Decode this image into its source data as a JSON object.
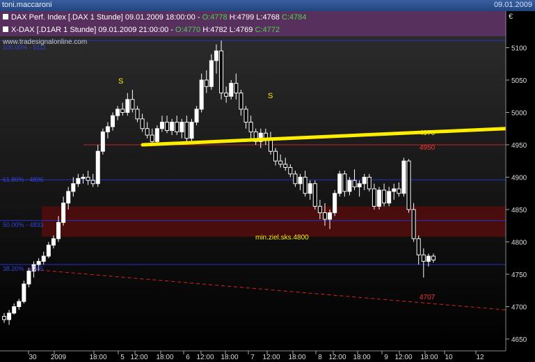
{
  "window": {
    "title": "toni.maccaroni",
    "date": "09.01.2009"
  },
  "legend": [
    {
      "text": "DAX Perf. Index [.DAX  1 Stunde] 09.01.2009 18:00:00 - ",
      "o": "O:4778",
      "h": "H:4799",
      "l": "L:4768",
      "c": "C:4784"
    },
    {
      "text": "X-DAX [.D1AR  1 Stunde] 09.01.2009 21:00:00 - ",
      "o": "O:4770",
      "h": "H:4782",
      "l": "L:4769",
      "c": "C:4772"
    }
  ],
  "watermark": "www.tradesignalonline.com",
  "currency": "€",
  "annotations": {
    "s1": "S",
    "s2": "S",
    "level_4970": "4970",
    "level_4950": "4950",
    "level_4707": "4707",
    "target": "min.ziel.sks.4800"
  },
  "fib_labels": [
    "61.80% - 4896",
    "50.00% - 4833",
    "38.20% - 4765",
    "100.00% - 5111"
  ],
  "colors": {
    "up": "#ffffff",
    "down": "#ffffff",
    "trend": "#ffee00",
    "support_red": "#cc2222",
    "zone": "#4a0d0d",
    "hline": "#2233cc",
    "bg_top": "#2e2e2e",
    "bg_bottom": "#000000"
  },
  "chart_data": {
    "type": "candlestick",
    "y_ticks": [
      4650,
      4700,
      4750,
      4800,
      4850,
      4900,
      4950,
      5000,
      5050,
      5100
    ],
    "y_tick_labels": [
      "4650",
      "4700",
      "4750",
      "4800",
      "4850",
      "4900",
      "4950",
      "5000",
      "5050",
      "5100"
    ],
    "ylim": [
      4630,
      5135
    ],
    "x_labels": [
      "30",
      "2009",
      "18:00",
      "5",
      "12:00",
      "18:00",
      "6",
      "12:00",
      "18:00",
      "7",
      "12:00",
      "18:00",
      "8",
      "12:00",
      "18:00",
      "9",
      "12:00",
      "18:00",
      "10",
      "12"
    ],
    "horizontal_lines": [
      5111,
      4896,
      4833,
      4765
    ],
    "red_level": 4950,
    "zone": [
      4808,
      4855
    ],
    "candles": [
      [
        4685,
        4690,
        4675,
        4680
      ],
      [
        4680,
        4695,
        4672,
        4690
      ],
      [
        4690,
        4705,
        4688,
        4700
      ],
      [
        4700,
        4712,
        4695,
        4708
      ],
      [
        4708,
        4740,
        4705,
        4735
      ],
      [
        4735,
        4760,
        4730,
        4755
      ],
      [
        4755,
        4770,
        4745,
        4765
      ],
      [
        4765,
        4775,
        4755,
        4770
      ],
      [
        4770,
        4785,
        4765,
        4778
      ],
      [
        4778,
        4800,
        4775,
        4795
      ],
      [
        4795,
        4810,
        4790,
        4805
      ],
      [
        4805,
        4840,
        4800,
        4830
      ],
      [
        4830,
        4870,
        4825,
        4860
      ],
      [
        4860,
        4885,
        4850,
        4878
      ],
      [
        4878,
        4900,
        4870,
        4890
      ],
      [
        4890,
        4905,
        4885,
        4898
      ],
      [
        4898,
        4905,
        4890,
        4900
      ],
      [
        4900,
        4910,
        4888,
        4895
      ],
      [
        4895,
        4905,
        4885,
        4890
      ],
      [
        4890,
        4950,
        4885,
        4940
      ],
      [
        4940,
        4975,
        4935,
        4970
      ],
      [
        4970,
        4985,
        4960,
        4978
      ],
      [
        4978,
        5000,
        4972,
        4995
      ],
      [
        4995,
        5010,
        4988,
        5005
      ],
      [
        5005,
        5015,
        4995,
        5000
      ],
      [
        5000,
        5030,
        4995,
        5020
      ],
      [
        5020,
        5035,
        5000,
        5005
      ],
      [
        5005,
        5010,
        4985,
        4990
      ],
      [
        4990,
        4998,
        4970,
        4975
      ],
      [
        4975,
        4985,
        4960,
        4965
      ],
      [
        4965,
        4975,
        4950,
        4955
      ],
      [
        4955,
        4980,
        4950,
        4975
      ],
      [
        4975,
        4995,
        4970,
        4985
      ],
      [
        4985,
        4995,
        4968,
        4972
      ],
      [
        4972,
        4990,
        4965,
        4985
      ],
      [
        4985,
        4995,
        4965,
        4970
      ],
      [
        4970,
        4990,
        4960,
        4985
      ],
      [
        4985,
        4995,
        4955,
        4960
      ],
      [
        4960,
        4990,
        4955,
        4985
      ],
      [
        4985,
        5010,
        4980,
        5005
      ],
      [
        5005,
        5060,
        5000,
        5050
      ],
      [
        5050,
        5065,
        5030,
        5040
      ],
      [
        5040,
        5090,
        5035,
        5080
      ],
      [
        5080,
        5105,
        5060,
        5095
      ],
      [
        5095,
        5111,
        5020,
        5030
      ],
      [
        5030,
        5040,
        5015,
        5025
      ],
      [
        5025,
        5050,
        5020,
        5045
      ],
      [
        5045,
        5060,
        5020,
        5030
      ],
      [
        5030,
        5035,
        4995,
        5005
      ],
      [
        5005,
        5010,
        4975,
        4985
      ],
      [
        4985,
        4995,
        4960,
        4970
      ],
      [
        4970,
        4975,
        4950,
        4955
      ],
      [
        4955,
        4975,
        4945,
        4968
      ],
      [
        4968,
        4975,
        4950,
        4960
      ],
      [
        4960,
        4970,
        4935,
        4940
      ],
      [
        4940,
        4945,
        4918,
        4925
      ],
      [
        4925,
        4935,
        4915,
        4920
      ],
      [
        4920,
        4930,
        4910,
        4915
      ],
      [
        4915,
        4920,
        4900,
        4905
      ],
      [
        4905,
        4910,
        4885,
        4890
      ],
      [
        4890,
        4905,
        4880,
        4900
      ],
      [
        4900,
        4910,
        4870,
        4875
      ],
      [
        4875,
        4895,
        4865,
        4890
      ],
      [
        4890,
        4895,
        4850,
        4855
      ],
      [
        4855,
        4865,
        4835,
        4845
      ],
      [
        4845,
        4860,
        4825,
        4835
      ],
      [
        4835,
        4850,
        4820,
        4845
      ],
      [
        4845,
        4880,
        4840,
        4875
      ],
      [
        4875,
        4910,
        4870,
        4905
      ],
      [
        4905,
        4910,
        4870,
        4878
      ],
      [
        4878,
        4900,
        4872,
        4895
      ],
      [
        4895,
        4912,
        4880,
        4885
      ],
      [
        4885,
        4895,
        4870,
        4890
      ],
      [
        4890,
        4905,
        4880,
        4900
      ],
      [
        4900,
        4905,
        4878,
        4882
      ],
      [
        4882,
        4890,
        4850,
        4855
      ],
      [
        4855,
        4885,
        4850,
        4880
      ],
      [
        4880,
        4890,
        4855,
        4860
      ],
      [
        4860,
        4885,
        4855,
        4878
      ],
      [
        4878,
        4890,
        4865,
        4882
      ],
      [
        4882,
        4892,
        4870,
        4875
      ],
      [
        4875,
        4930,
        4870,
        4925
      ],
      [
        4925,
        4928,
        4845,
        4850
      ],
      [
        4850,
        4860,
        4800,
        4805
      ],
      [
        4805,
        4810,
        4765,
        4780
      ],
      [
        4780,
        4790,
        4745,
        4770
      ],
      [
        4770,
        4782,
        4762,
        4778
      ],
      [
        4778,
        4782,
        4768,
        4772
      ]
    ],
    "trend_line": {
      "from": [
        4950,
        4950
      ],
      "to_value": 4975,
      "label": "4970"
    },
    "dashed_support": {
      "start": 4758,
      "end": 4695,
      "label": "4707"
    }
  }
}
